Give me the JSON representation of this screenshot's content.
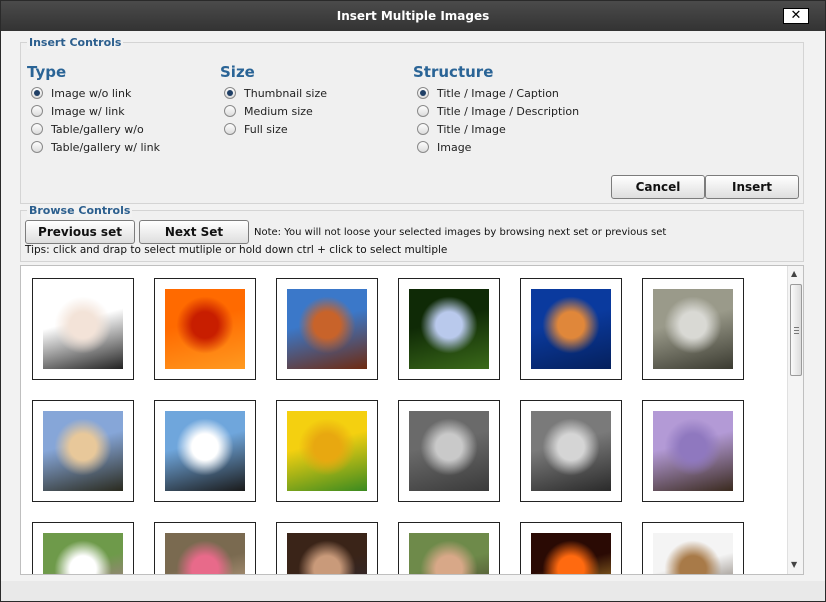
{
  "dialog": {
    "title": "Insert Multiple Images",
    "close_label": "✕"
  },
  "insert_controls": {
    "legend": "Insert Controls",
    "type": {
      "heading": "Type",
      "options": [
        {
          "label": "Image w/o link",
          "selected": true
        },
        {
          "label": "Image w/ link",
          "selected": false
        },
        {
          "label": "Table/gallery w/o",
          "selected": false
        },
        {
          "label": "Table/gallery w/ link",
          "selected": false
        }
      ]
    },
    "size": {
      "heading": "Size",
      "options": [
        {
          "label": "Thumbnail size",
          "selected": true
        },
        {
          "label": "Medium size",
          "selected": false
        },
        {
          "label": "Full size",
          "selected": false
        }
      ]
    },
    "structure": {
      "heading": "Structure",
      "options": [
        {
          "label": "Title / Image / Caption",
          "selected": true
        },
        {
          "label": "Title / Image / Description",
          "selected": false
        },
        {
          "label": "Title / Image",
          "selected": false
        },
        {
          "label": "Image",
          "selected": false
        }
      ]
    },
    "cancel_label": "Cancel",
    "insert_label": "Insert"
  },
  "browse_controls": {
    "legend": "Browse Controls",
    "previous_label": "Previous set",
    "next_label": "Next Set",
    "note": "Note: You will not loose your selected images by browsing next set or previous set",
    "tips": "Tips: click and drap to select mutliple or hold down ctrl + click to select multiple"
  },
  "thumbnails": [
    {
      "name": "thumb-webpage-screenshot",
      "colors": [
        "#ffffff",
        "#f3e3d8",
        "#222222"
      ]
    },
    {
      "name": "thumb-red-flower",
      "colors": [
        "#ff6a00",
        "#c81e00",
        "#ff9a20"
      ]
    },
    {
      "name": "thumb-desert-butte",
      "colors": [
        "#3b78c9",
        "#c8632a",
        "#6e2a10"
      ]
    },
    {
      "name": "thumb-hydrangea",
      "colors": [
        "#0f2a06",
        "#b9c9ec",
        "#3b6a1a"
      ]
    },
    {
      "name": "thumb-jellyfish",
      "colors": [
        "#0a3a9e",
        "#e0873a",
        "#05205c"
      ]
    },
    {
      "name": "thumb-koala",
      "colors": [
        "#9a9a8a",
        "#d9d9d4",
        "#3a3a30"
      ]
    },
    {
      "name": "thumb-lighthouse",
      "colors": [
        "#86a6d8",
        "#e8c89a",
        "#2a2a1e"
      ]
    },
    {
      "name": "thumb-penguins",
      "colors": [
        "#6fa6dc",
        "#ffffff",
        "#1a1a1a"
      ]
    },
    {
      "name": "thumb-tulips",
      "colors": [
        "#f4d010",
        "#e8a810",
        "#3a8a20"
      ]
    },
    {
      "name": "thumb-baby-grayscale-1",
      "colors": [
        "#6a6a6a",
        "#c9c9c9",
        "#3a3a3a"
      ]
    },
    {
      "name": "thumb-baby-grayscale-2",
      "colors": [
        "#7a7a7a",
        "#d5d5d5",
        "#2a2a2a"
      ]
    },
    {
      "name": "thumb-dog-on-blanket",
      "colors": [
        "#b39ad6",
        "#8f78bf",
        "#3a2a1e"
      ]
    },
    {
      "name": "thumb-wedding-group",
      "colors": [
        "#6e9a4a",
        "#ffffff",
        "#c86ab0"
      ]
    },
    {
      "name": "thumb-couple-photo",
      "colors": [
        "#7a6a50",
        "#e86a8a",
        "#d9b89a"
      ]
    },
    {
      "name": "thumb-two-people",
      "colors": [
        "#3a2418",
        "#c99a7a",
        "#2a2a3a"
      ]
    },
    {
      "name": "thumb-couple-outdoors",
      "colors": [
        "#6e8a4a",
        "#d8a888",
        "#3a2a20"
      ]
    },
    {
      "name": "thumb-fire",
      "colors": [
        "#2a0a04",
        "#ff6a10",
        "#f0c040"
      ]
    },
    {
      "name": "thumb-comic-dogs",
      "colors": [
        "#f4f4f4",
        "#a87a48",
        "#3a2a1a"
      ]
    }
  ]
}
